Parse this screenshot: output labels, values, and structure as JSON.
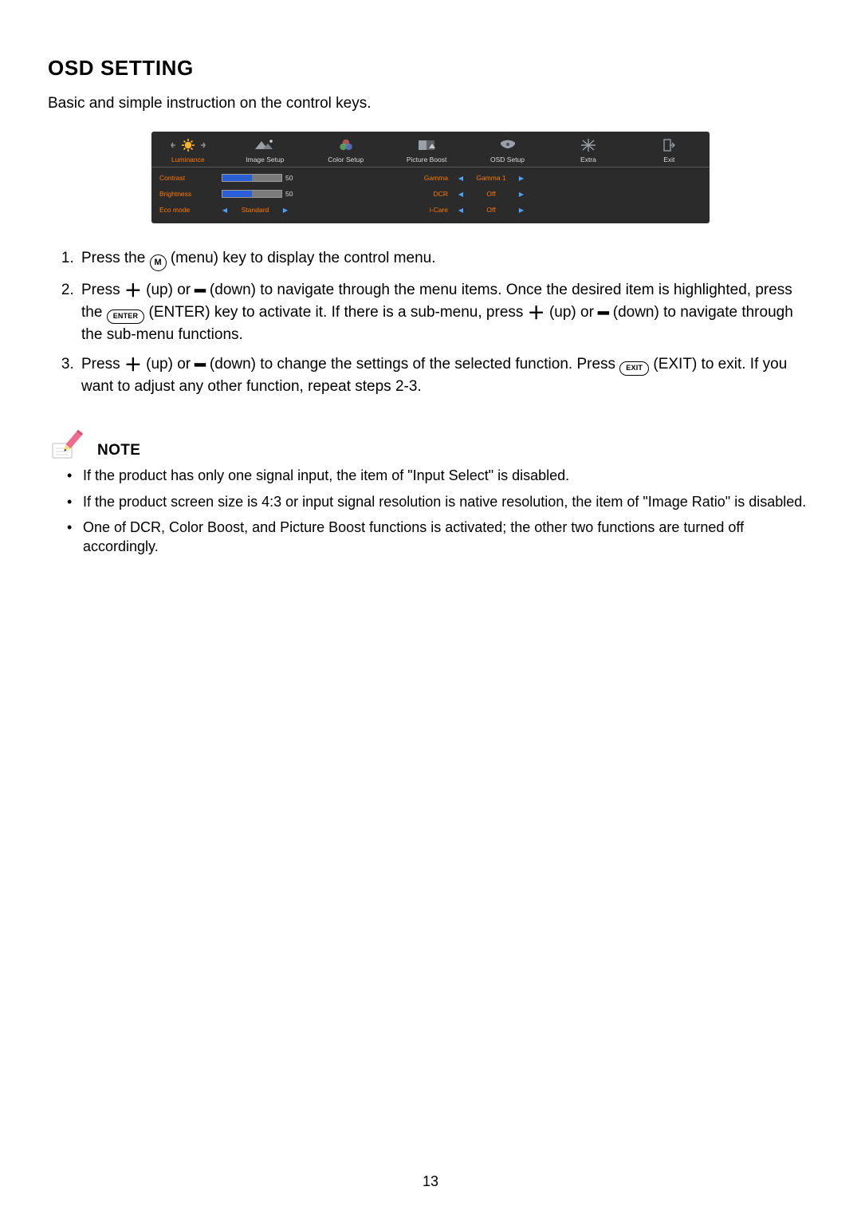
{
  "section_title": "OSD SETTING",
  "intro": "Basic and simple instruction on the control keys.",
  "osd": {
    "tabs": [
      {
        "label": "Luminance",
        "icon": "sun-icon",
        "active": true
      },
      {
        "label": "Image Setup",
        "icon": "image-setup-icon",
        "active": false
      },
      {
        "label": "Color Setup",
        "icon": "rgb-icon",
        "active": false
      },
      {
        "label": "Picture Boost",
        "icon": "picture-boost-icon",
        "active": false
      },
      {
        "label": "OSD Setup",
        "icon": "osd-setup-icon",
        "active": false
      },
      {
        "label": "Extra",
        "icon": "extra-icon",
        "active": false
      },
      {
        "label": "Exit",
        "icon": "exit-icon",
        "active": false
      }
    ],
    "left_items": [
      {
        "label": "Contrast",
        "value": "50",
        "kind": "slider",
        "fill": 50
      },
      {
        "label": "Brightness",
        "value": "50",
        "kind": "slider",
        "fill": 50
      },
      {
        "label": "Eco mode",
        "value": "Standard",
        "kind": "select"
      }
    ],
    "right_items": [
      {
        "label": "Gamma",
        "value": "Gamma 1"
      },
      {
        "label": "DCR",
        "value": "Off"
      },
      {
        "label": "i-Care",
        "value": "Off"
      }
    ]
  },
  "keys": {
    "menu_glyph": "M",
    "enter_glyph": "ENTER",
    "exit_glyph": "EXIT"
  },
  "steps": {
    "s1_a": "Press the ",
    "s1_b": " (menu) key to display the control menu.",
    "s2_a": "Press ",
    "s2_b": " (up) or ",
    "s2_c": " (down) to navigate through the menu items. Once the desired item is highlighted, press the ",
    "s2_d": " (ENTER) key to activate it. If there is a sub-menu, press ",
    "s2_e": " (up) or ",
    "s2_f": " (down) to navigate through the sub-menu functions.",
    "s3_a": "Press ",
    "s3_b": " (up) or ",
    "s3_c": " (down) to change the settings of the selected function. Press ",
    "s3_d": " (EXIT) to exit. If you want to adjust any other function, repeat steps 2-3."
  },
  "note_title": "NOTE",
  "notes": [
    "If the product has only one signal input, the item of \"Input Select\" is disabled.",
    "If the product screen size is 4:3 or input signal resolution is native resolution, the item of \"Image Ratio\" is disabled.",
    "One of DCR, Color Boost, and Picture Boost functions is activated; the other two functions are turned off accordingly."
  ],
  "page_number": "13"
}
